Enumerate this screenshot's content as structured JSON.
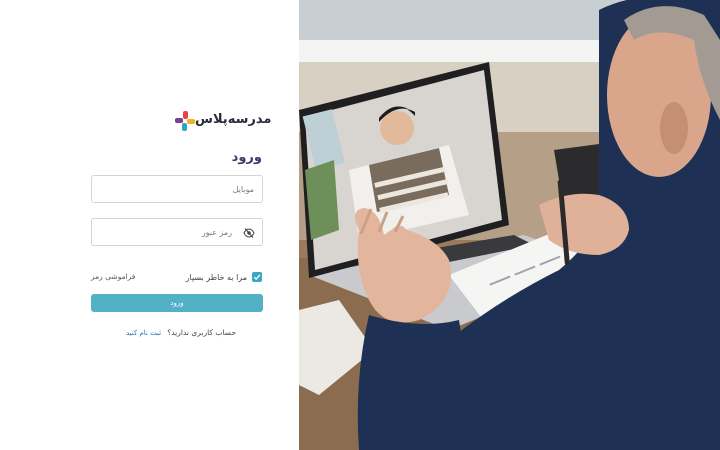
{
  "brand": {
    "name": "مدرسه‌پلاس",
    "colors": [
      "#e8424a",
      "#f5b01f",
      "#2fa5c6",
      "#7b3f98"
    ]
  },
  "login": {
    "title": "ورود",
    "mobile_placeholder": "موبایل",
    "password_placeholder": "رمز عبور",
    "remember_label": "مرا به خاطر بسپار",
    "remember_checked": true,
    "forgot_label": "فراموشی رمز",
    "submit_label": "ورود",
    "no_account_label": "حساب کاربری ندارید؟",
    "signup_label": "ثبت نام کنید"
  },
  "colors": {
    "accent": "#52b0c7",
    "link": "#2e73b8"
  },
  "icons": {
    "password_toggle": "eye-slash-icon",
    "checkbox": "check-icon"
  }
}
